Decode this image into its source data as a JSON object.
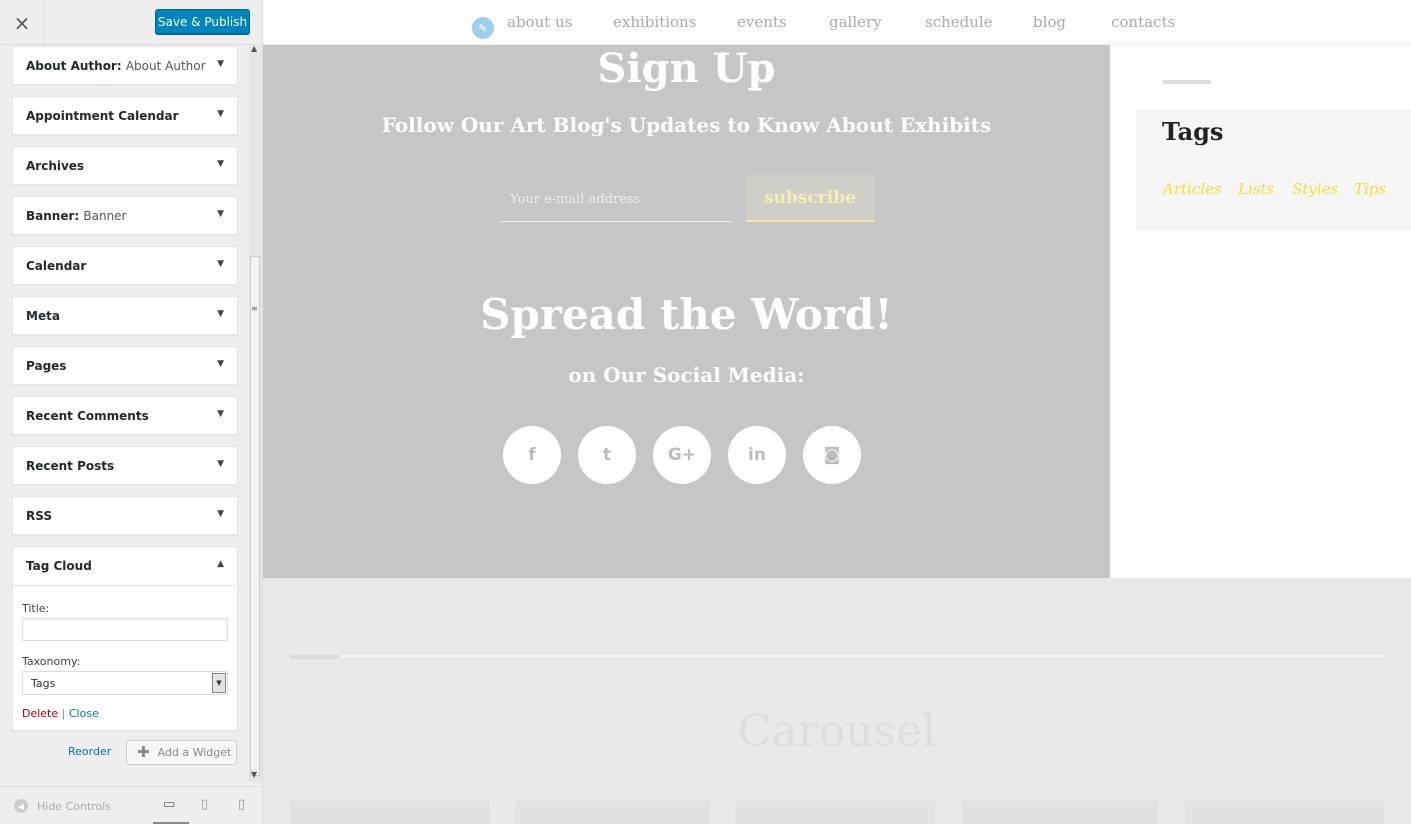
{
  "sidebar": {
    "close_icon": "×",
    "publish_label": "Save & Publish",
    "widgets": [
      {
        "title": "About Author:",
        "sub": "About Author"
      },
      {
        "title": "Appointment Calendar",
        "sub": ""
      },
      {
        "title": "Archives",
        "sub": ""
      },
      {
        "title": "Banner:",
        "sub": "Banner"
      },
      {
        "title": "Calendar",
        "sub": ""
      },
      {
        "title": "Meta",
        "sub": ""
      },
      {
        "title": "Pages",
        "sub": ""
      },
      {
        "title": "Recent Comments",
        "sub": ""
      },
      {
        "title": "Recent Posts",
        "sub": ""
      },
      {
        "title": "RSS",
        "sub": ""
      }
    ],
    "open_widget": {
      "title": "Tag Cloud",
      "title_label": "Title:",
      "title_value": "",
      "taxonomy_label": "Taxonomy:",
      "taxonomy_value": "Tags",
      "delete_label": "Delete",
      "separator": "|",
      "close_label": "Close"
    },
    "reorder_label": "Reorder",
    "add_widget_label": "Add a Widget",
    "hide_controls_label": "Hide Controls"
  },
  "preview": {
    "nav": [
      "about us",
      "exhibitions",
      "events",
      "gallery",
      "schedule",
      "blog",
      "contacts"
    ],
    "signup_title": "Sign Up",
    "signup_subtitle": "Follow Our Art Blog's Updates to Know About Exhibits",
    "email_placeholder": "Your e-mail address",
    "subscribe_label": "subscribe",
    "spread_title": "Spread the Word!",
    "social_subtitle": "on Our Social Media:",
    "social_icons": [
      "facebook-icon",
      "twitter-icon",
      "google-plus-icon",
      "linkedin-icon",
      "instagram-icon"
    ],
    "social_glyphs": [
      "f",
      "t",
      "G+",
      "in",
      "◙"
    ],
    "tags_title": "Tags",
    "tags": [
      "Articles",
      "Lists",
      "Styles",
      "Tips"
    ],
    "carousel_title": "Carousel"
  },
  "colors": {
    "publish_button": "#0085ba",
    "tag_link": "#f0e03c",
    "delete_link": "#aa0000",
    "link": "#0073aa"
  }
}
